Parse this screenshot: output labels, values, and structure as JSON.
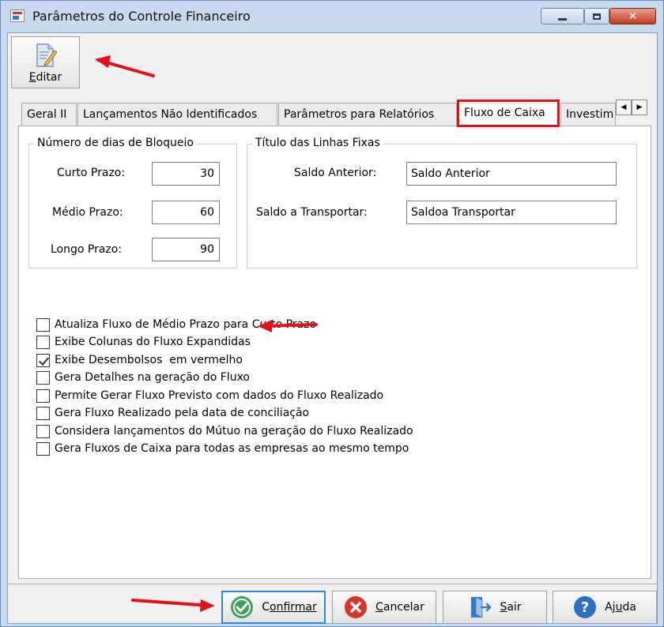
{
  "window": {
    "title": "Parâmetros do Controle Financeiro",
    "controls": {
      "minimize": "minimize",
      "maximize": "maximize",
      "close": "✕"
    }
  },
  "toolbar": {
    "edit_label_u": "E",
    "edit_label_rest": "ditar",
    "edit_icon": "edit-document-icon"
  },
  "tabs": [
    {
      "label": "Geral II",
      "active": false
    },
    {
      "label": "Lançamentos Não Identificados",
      "active": false
    },
    {
      "label": "Parâmetros para Relatórios",
      "active": false
    },
    {
      "label": "Fluxo de Caixa",
      "active": true
    },
    {
      "label": "Investim",
      "active": false
    }
  ],
  "tab_scroll": {
    "left": "◀",
    "right": "▶"
  },
  "blocking_days": {
    "title": "Número de dias de Bloqueio",
    "fields": [
      {
        "label": "Curto Prazo:",
        "value": "30"
      },
      {
        "label": "Médio Prazo:",
        "value": "60"
      },
      {
        "label": "Longo Prazo:",
        "value": "90"
      }
    ]
  },
  "fixed_lines": {
    "title": "Título das Linhas Fixas",
    "fields": [
      {
        "label": "Saldo Anterior:",
        "value": "Saldo Anterior"
      },
      {
        "label": "Saldo a Transportar:",
        "value": "Saldoa Transportar"
      }
    ]
  },
  "options": [
    {
      "label": "Atualiza Fluxo de Médio Prazo para Curto Prazo",
      "checked": false
    },
    {
      "label": "Exibe Colunas do Fluxo Expandidas",
      "checked": false
    },
    {
      "label": "Exibe Desembolsos  em vermelho",
      "checked": true
    },
    {
      "label": "Gera Detalhes na geração do Fluxo",
      "checked": false
    },
    {
      "label": "Permite Gerar Fluxo Previsto com dados do Fluxo Realizado",
      "checked": false
    },
    {
      "label": "Gera Fluxo Realizado pela data de conciliação",
      "checked": false
    },
    {
      "label": "Considera lançamentos do Mútuo na geração do Fluxo Realizado",
      "checked": false
    },
    {
      "label": "Gera Fluxos de Caixa para todas as empresas ao mesmo tempo",
      "checked": false
    }
  ],
  "actions": {
    "confirm": {
      "u": "C",
      "rest": "onfirmar",
      "icon": "check-circle-icon",
      "color": "#3aa55a"
    },
    "cancel": {
      "u": "C",
      "rest": "ancelar",
      "icon": "x-circle-icon",
      "color": "#d8342a"
    },
    "exit": {
      "u": "S",
      "rest": "air",
      "icon": "exit-door-icon",
      "color": "#3a78c2"
    },
    "help": {
      "pre": "Aj",
      "u": "u",
      "post": "da",
      "icon": "help-circle-icon",
      "color": "#2f6fc0"
    }
  },
  "colors": {
    "annotation": "#e3101a",
    "accent": "#2e86d1"
  }
}
